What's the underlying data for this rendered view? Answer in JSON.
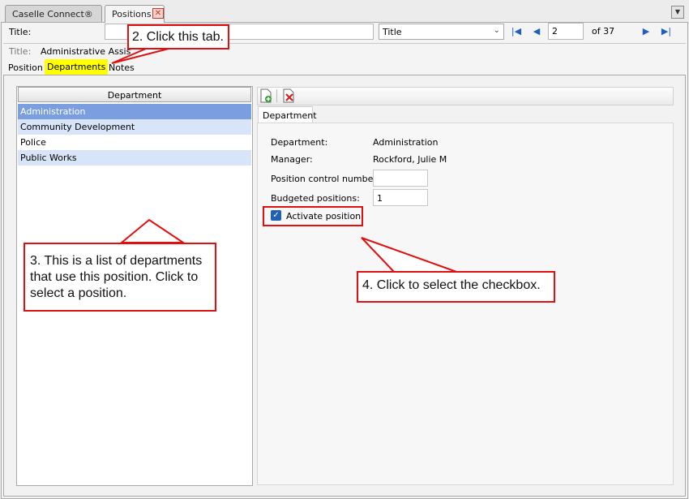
{
  "window_tabs": [
    {
      "label": "Caselle Connect®"
    },
    {
      "label": "Positions"
    }
  ],
  "lookup": {
    "label": "Title:",
    "input_value": "",
    "field_select": "Title",
    "record_value": "2",
    "record_total": "of 37"
  },
  "record_header": {
    "label": "Title:",
    "value": "Administrative Assistant"
  },
  "tabs": {
    "position": "Position",
    "departments": "Departments",
    "notes": "Notes"
  },
  "department_list": {
    "header": "Department",
    "rows": [
      {
        "name": "Administration"
      },
      {
        "name": "Community Development"
      },
      {
        "name": "Police"
      },
      {
        "name": "Public Works"
      }
    ]
  },
  "detail": {
    "tab_label": "Department",
    "department_label": "Department:",
    "department_value": "Administration",
    "manager_label": "Manager:",
    "manager_value": "Rockford, Julie M",
    "pcn_label": "Position control number:",
    "pcn_value": "",
    "budgeted_label": "Budgeted positions:",
    "budgeted_value": "1",
    "activate_label": "Activate position",
    "activate_checked": true
  },
  "annotations": {
    "step2": "2. Click this tab.",
    "step3": "3. This is a list of departments that use this position. Click to select a position.",
    "step4": "4. Click to select the checkbox."
  },
  "colors": {
    "selected_row": "#7b9ee0",
    "alt_row": "#d8e5f8",
    "highlight_tab": "#ffff00",
    "callout_border": "#e01010",
    "checkbox_blue": "#1e62b4"
  }
}
